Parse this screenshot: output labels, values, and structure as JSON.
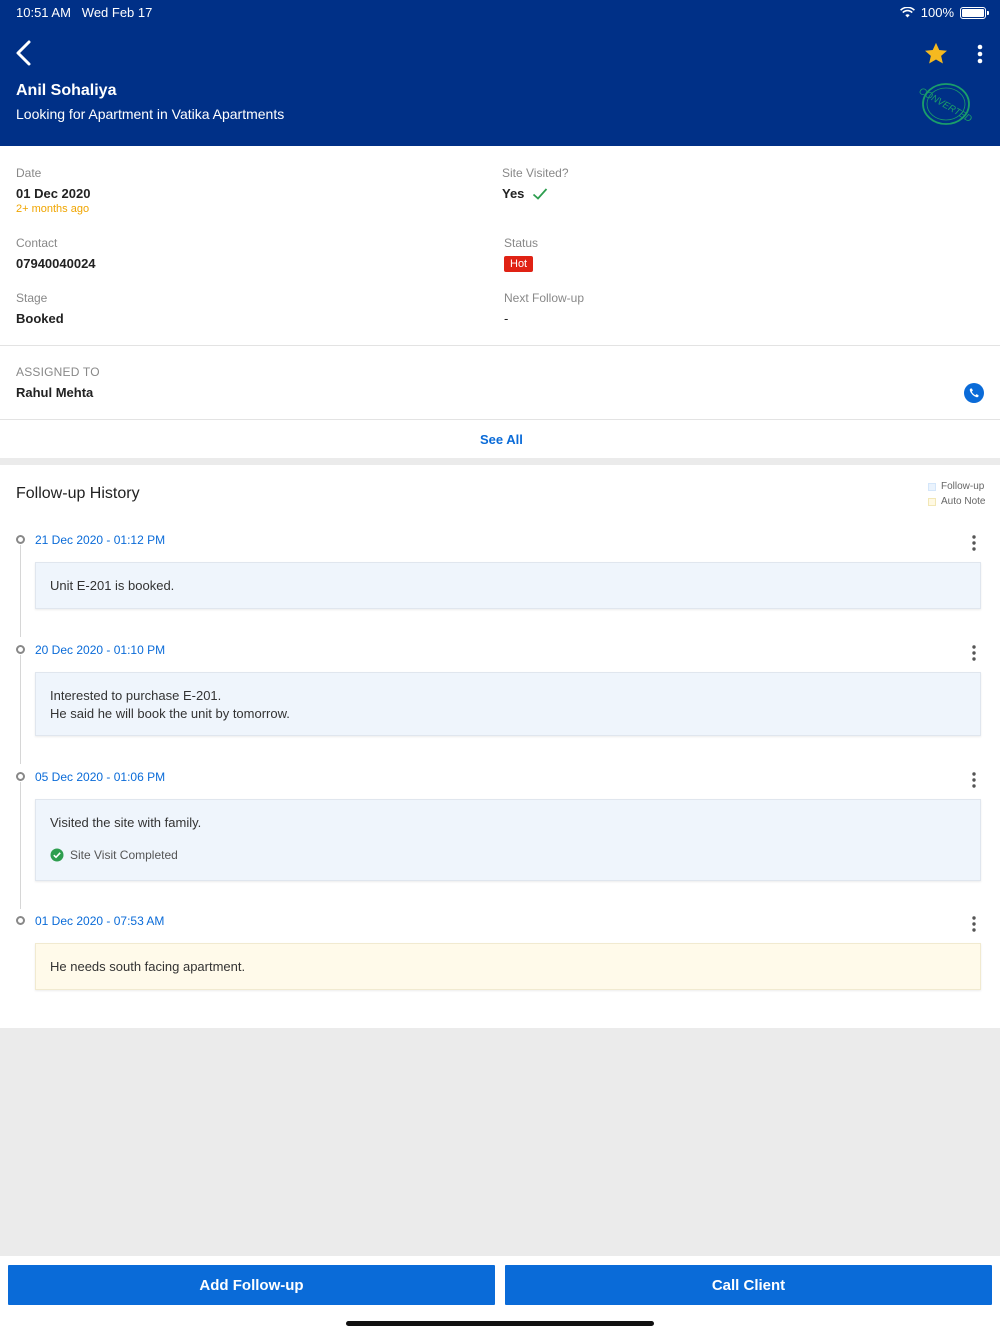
{
  "status_bar": {
    "time": "10:51 AM",
    "date": "Wed Feb 17",
    "battery": "100%"
  },
  "header": {
    "name": "Anil Sohaliya",
    "subtitle": "Looking for Apartment in Vatika Apartments",
    "stamp_text": "CONVERTED"
  },
  "details": {
    "date_label": "Date",
    "date_value": "01 Dec 2020",
    "date_ago": "2+ months ago",
    "site_visited_label": "Site Visited?",
    "site_visited_value": "Yes",
    "contact_label": "Contact",
    "contact_value": "07940040024",
    "status_label": "Status",
    "status_value": "Hot",
    "stage_label": "Stage",
    "stage_value": "Booked",
    "next_followup_label": "Next Follow-up",
    "next_followup_value": "-"
  },
  "assigned": {
    "label": "ASSIGNED TO",
    "name": "Rahul Mehta"
  },
  "see_all": "See All",
  "history": {
    "title": "Follow-up History",
    "legend": [
      "Follow-up",
      "Auto Note"
    ],
    "entries": [
      {
        "datetime": "21 Dec 2020 - 01:12 PM",
        "lines": [
          "Unit E-201 is booked."
        ]
      },
      {
        "datetime": "20 Dec 2020 - 01:10 PM",
        "lines": [
          "Interested to purchase E-201.",
          "He said he will book the unit by tomorrow."
        ]
      },
      {
        "datetime": "05 Dec 2020 - 01:06 PM",
        "lines": [
          "Visited the site with family."
        ],
        "tag": "Site Visit Completed"
      },
      {
        "datetime": "01 Dec 2020 - 07:53 AM",
        "lines": [
          "He needs south facing apartment."
        ]
      }
    ]
  },
  "actions": {
    "add_followup": "Add Follow-up",
    "call_client": "Call Client"
  },
  "colors": {
    "brand": "#003087",
    "accent": "#0a6bd8",
    "hot": "#e02214",
    "star": "#f5b91f",
    "stamp": "#1a9e6a"
  }
}
